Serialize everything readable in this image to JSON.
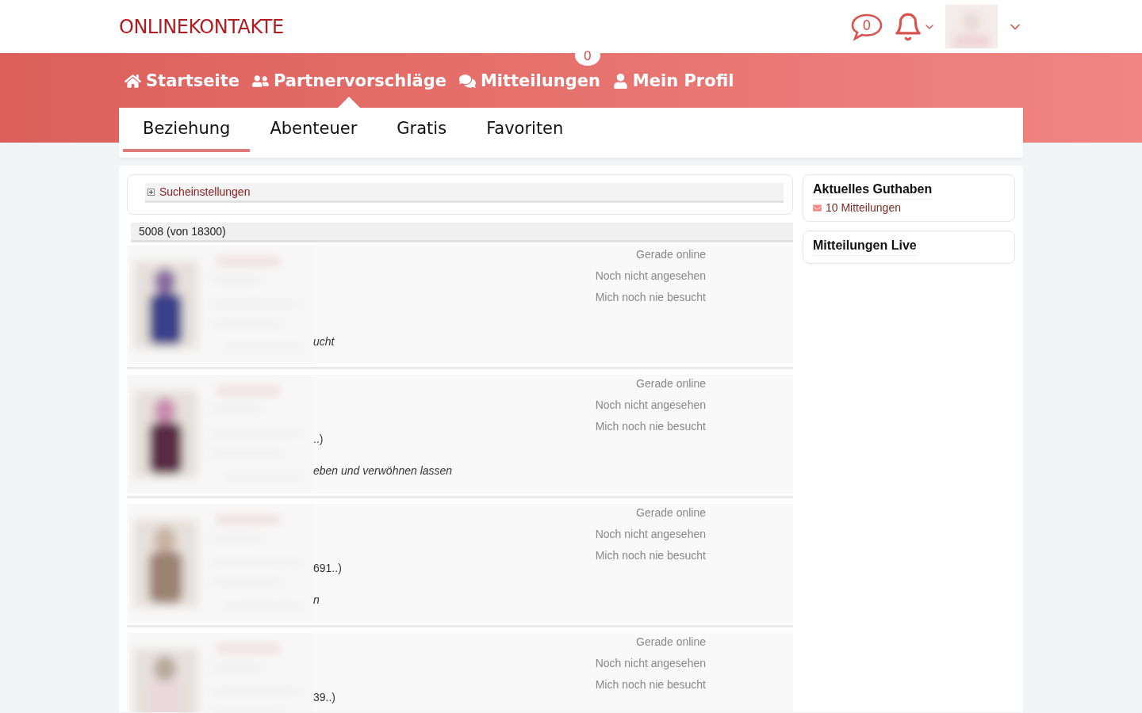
{
  "header": {
    "logo": "ONLINEKONTAKTE",
    "messages_count": "0"
  },
  "nav": [
    {
      "label": "Startseite",
      "selected": false
    },
    {
      "label": "Partnervorschläge",
      "selected": true
    },
    {
      "label": "Mitteilungen",
      "selected": false,
      "badge": "0"
    },
    {
      "label": "Mein Profil",
      "selected": false
    }
  ],
  "tabs": [
    {
      "label": "Beziehung",
      "selected": true
    },
    {
      "label": "Abenteuer",
      "selected": false
    },
    {
      "label": "Gratis",
      "selected": false
    },
    {
      "label": "Favoriten",
      "selected": false
    }
  ],
  "search_settings": {
    "label": "Sucheinstellungen",
    "expanded": false
  },
  "result_count": "5008 (von 18300)",
  "profiles": [
    {
      "statuses": [
        "Gerade online",
        "Noch nicht angesehen",
        "Mich noch nie besucht"
      ],
      "lines": [
        {
          "kind": "motto",
          "text": "ucht"
        }
      ]
    },
    {
      "statuses": [
        "Gerade online",
        "Noch nicht angesehen",
        "Mich noch nie besucht"
      ],
      "lines": [
        {
          "kind": "info",
          "text": "..)"
        },
        {
          "kind": "motto",
          "text": "eben und verwöhnen lassen"
        }
      ]
    },
    {
      "statuses": [
        "Gerade online",
        "Noch nicht angesehen",
        "Mich noch nie besucht"
      ],
      "lines": [
        {
          "kind": "info",
          "text": "691..)"
        },
        {
          "kind": "motto",
          "text": "n"
        }
      ]
    },
    {
      "statuses": [
        "Gerade online",
        "Noch nicht angesehen",
        "Mich noch nie besucht"
      ],
      "lines": [
        {
          "kind": "info",
          "text": "39..)"
        }
      ]
    }
  ],
  "sidebar": [
    {
      "title": "Aktuelles Guthaben",
      "credit": "10 Mitteilungen"
    },
    {
      "title": "Mitteilungen Live"
    }
  ]
}
